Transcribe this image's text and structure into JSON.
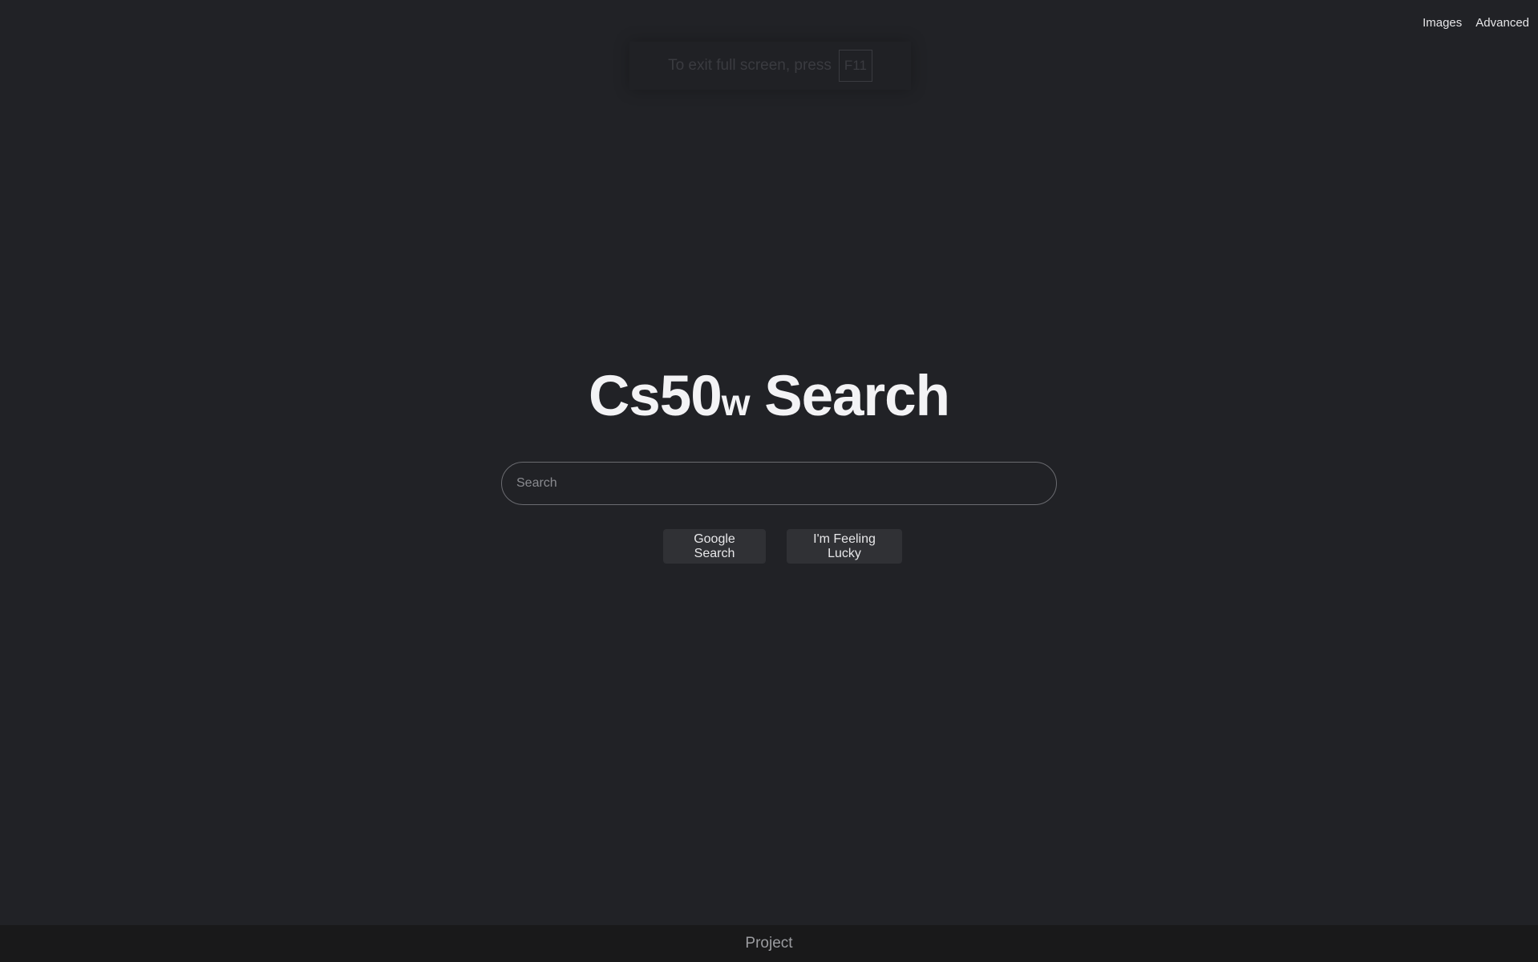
{
  "nav": {
    "images_label": "Images",
    "advanced_label": "Advanced"
  },
  "fullscreen_notice": {
    "text": "To exit full screen, press",
    "key": "F11"
  },
  "title": {
    "main_prefix": "Cs50",
    "sub": "w",
    "main_suffix": " Search"
  },
  "search": {
    "placeholder": "Search",
    "value": ""
  },
  "buttons": {
    "search_label": "Google Search",
    "lucky_label": "I'm Feeling Lucky"
  },
  "footer": {
    "text": "Project"
  },
  "colors": {
    "background": "#212226",
    "footer_background": "#19191a",
    "button_background": "#303135"
  }
}
